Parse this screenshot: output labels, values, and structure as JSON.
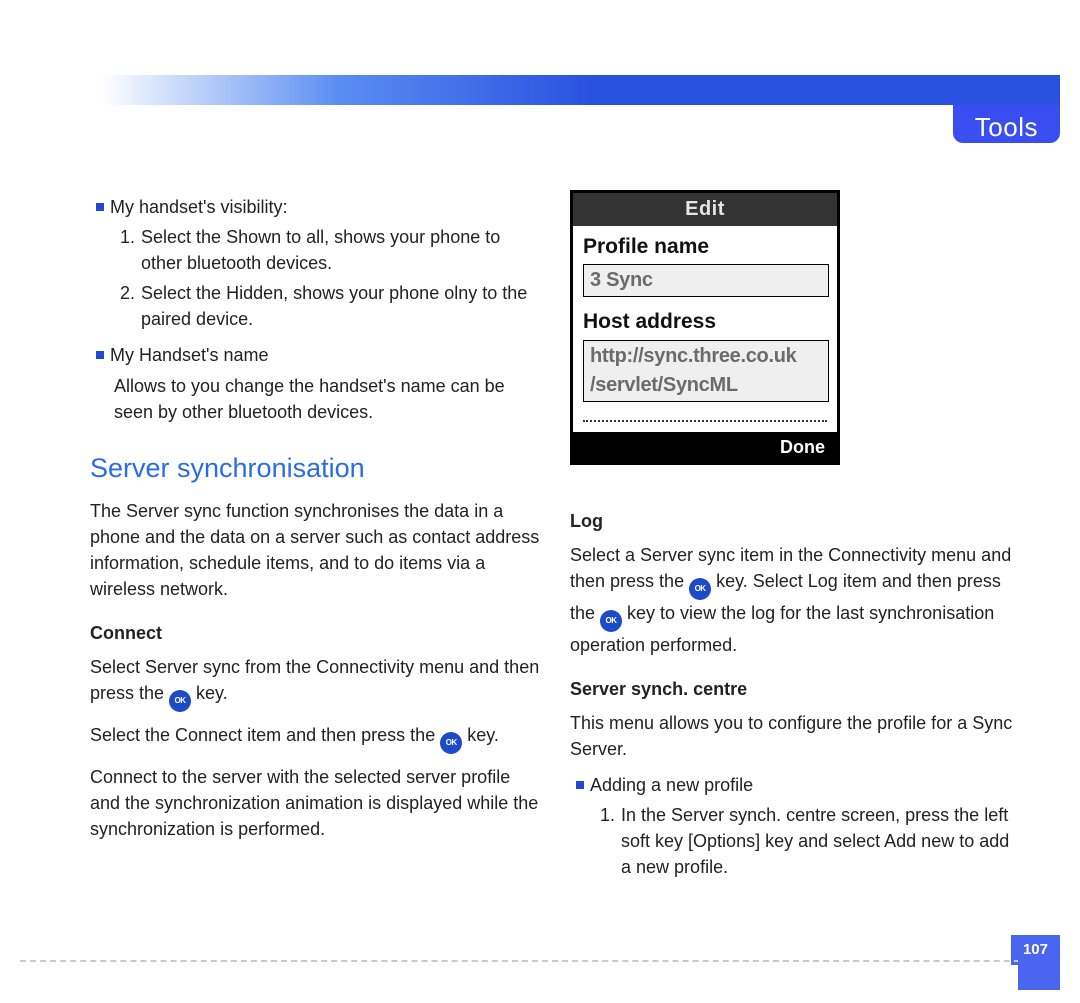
{
  "header": {
    "title": "Tools"
  },
  "left": {
    "b1": "My handset's visibility:",
    "b1_o1_n": "1.",
    "b1_o1": "Select the Shown to all, shows your phone to other bluetooth devices.",
    "b1_o2_n": "2.",
    "b1_o2": "Select the Hidden, shows your phone olny to the paired device.",
    "b2": "My Handset's name",
    "b2_after": "Allows to you change the handset's name can be seen by other bluetooth devices.",
    "h2": "Server synchronisation",
    "sync_p": "The Server sync function synchronises the data in a phone and the data on a server such as contact address information, schedule items, and to do items via a wireless network.",
    "connect_h": "Connect",
    "connect_p1a": "Select Server sync from the Connectivity menu and then press the ",
    "connect_p1b": " key.",
    "connect_p2a": "Select the Connect item and then press the ",
    "connect_p2b": " key.",
    "connect_p3": "Connect to the server with the selected server profile and the synchronization animation is displayed while the synchronization is performed."
  },
  "phone": {
    "title": "Edit",
    "label1": "Profile name",
    "value1": "3 Sync",
    "label2": "Host address",
    "value2a": "http://sync.three.co.uk",
    "value2b": "/servlet/SyncML",
    "done": "Done"
  },
  "right": {
    "log_h": "Log",
    "log_p_a": "Select a Server sync item in the Connectivity menu and then press the ",
    "log_p_b": " key. Select Log item and then press the ",
    "log_p_c": " key to view the log for the last synchronisation operation performed.",
    "ssc_h": "Server synch. centre",
    "ssc_p": "This menu allows you to configure the profile for a Sync Server.",
    "ssc_b1": "Adding a new profile",
    "ssc_o1_n": "1.",
    "ssc_o1": "In the Server synch. centre screen, press the left soft key [Options] key and select Add new to add a new profile."
  },
  "icons": {
    "ok": "OK"
  },
  "footer": {
    "page": "107"
  }
}
